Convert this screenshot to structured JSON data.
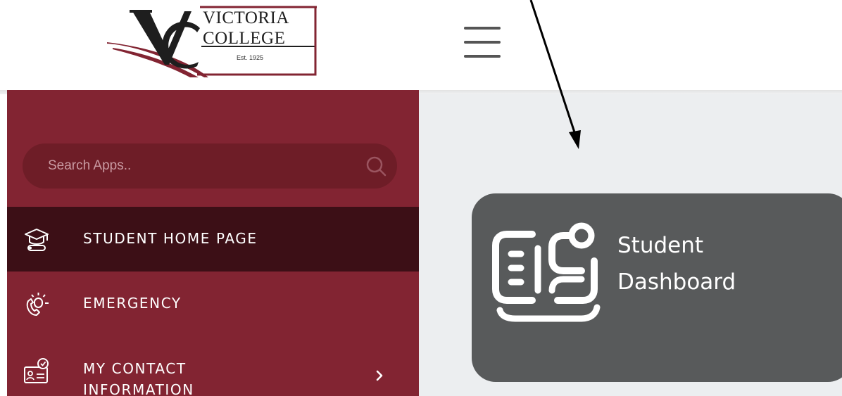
{
  "logo": {
    "name_line1": "VICTORIA",
    "name_line2": "COLLEGE",
    "established": "Est. 1925",
    "brand_color": "#822432"
  },
  "header": {
    "menu_icon": "hamburger-menu-icon"
  },
  "sidebar": {
    "background_color": "#822432",
    "search": {
      "placeholder": "Search Apps..",
      "icon": "search-icon"
    },
    "items": [
      {
        "label": "STUDENT HOME PAGE",
        "icon": "graduation-cap-icon",
        "active": true
      },
      {
        "label": "EMERGENCY",
        "icon": "emergency-phone-icon",
        "active": false
      },
      {
        "label_line1": "MY CONTACT",
        "label_line2": "INFORMATION",
        "icon": "contact-card-icon",
        "has_submenu": true
      }
    ]
  },
  "main": {
    "background_color": "#eceef0",
    "tiles": [
      {
        "label_line1": "Student",
        "label_line2": "Dashboard",
        "icon": "dashboard-icon",
        "background_color": "#585a5b"
      }
    ]
  },
  "annotation": {
    "arrow_points_to": "tile-student-dashboard",
    "arrow_color": "#000000"
  }
}
